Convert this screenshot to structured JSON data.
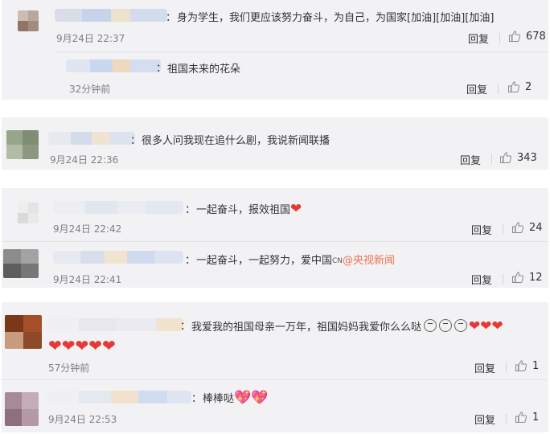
{
  "comments": [
    {
      "text": "身为学生，我们更应该努力奋斗，为自己，为国家[加油][加油][加油]",
      "time": "9月24日 22:37",
      "reply_label": "回复",
      "likes": "678",
      "sub_reply": {
        "text": "祖国未来的花朵",
        "time": "32分钟前",
        "reply_label": "回复",
        "likes": "2"
      }
    },
    {
      "text": "很多人问我现在追什么剧，我说新闻联播",
      "time": "9月24日 22:36",
      "reply_label": "回复",
      "likes": "343"
    },
    {
      "text": "一起奋斗，报效祖国",
      "time": "9月24日 22:42",
      "reply_label": "回复",
      "likes": "24",
      "sub_reply": {
        "text": "一起奋斗，一起努力，爱中国",
        "cn_tag": "CN",
        "mention": "@央视新闻",
        "time": "9月24日 22:41",
        "reply_label": "回复",
        "likes": "12"
      }
    },
    {
      "text": "我爱我的祖国母亲一万年，祖国妈妈我爱你么么哒",
      "time": "57分钟前",
      "reply_label": "回复",
      "likes": "1"
    },
    {
      "text": "棒棒哒",
      "time": "9月24日 22:53",
      "reply_label": "回复",
      "likes": "1"
    }
  ],
  "colon": "：",
  "icons": {
    "like": "thumbs-up-icon",
    "heart": "red-heart-emoji",
    "kiss": "kiss-emoji",
    "pink_heart": "pink-heart-emoji"
  },
  "colors": {
    "block_bg": "#f2f2f5",
    "time": "#808080",
    "mention": "#eb7350",
    "heart": "#e53935"
  }
}
